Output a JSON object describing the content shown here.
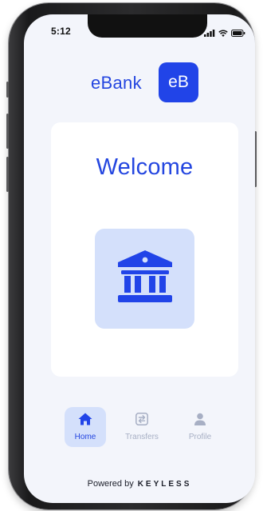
{
  "status_bar": {
    "time": "5:12"
  },
  "header": {
    "brand_name": "eBank",
    "logo_text": "eB"
  },
  "main": {
    "title": "Welcome",
    "icon": "bank-building-icon"
  },
  "nav": {
    "items": [
      {
        "label": "Home",
        "icon": "home-icon",
        "active": true
      },
      {
        "label": "Transfers",
        "icon": "transfer-icon",
        "active": false
      },
      {
        "label": "Profile",
        "icon": "user-icon",
        "active": false
      }
    ]
  },
  "footer": {
    "powered_by": "Powered by",
    "brand": "KEYLESS"
  },
  "colors": {
    "accent": "#2446e0",
    "tile_bg": "#d4e0fb",
    "inactive": "#a7afc4",
    "screen_bg": "#f3f5fb"
  }
}
